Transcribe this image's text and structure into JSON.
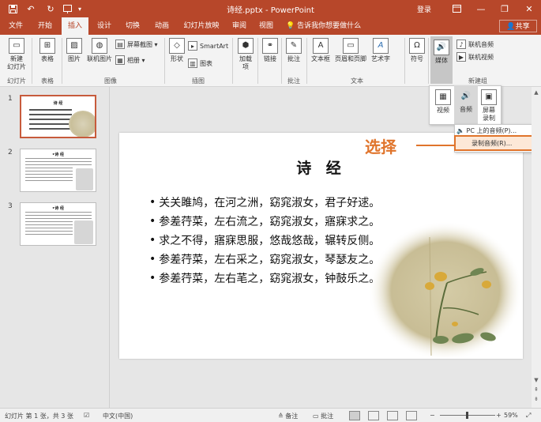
{
  "titlebar": {
    "doc_title": "诗经.pptx - PowerPoint",
    "login": "登录",
    "minimize": "—",
    "restore": "❐",
    "close": "✕"
  },
  "tabs": [
    "文件",
    "开始",
    "插入",
    "设计",
    "切换",
    "动画",
    "幻灯片放映",
    "审阅",
    "视图"
  ],
  "tell_me": "告诉我你想要做什么",
  "share": "共享",
  "ribbon": {
    "new_slide_1": "新建",
    "new_slide_2": "幻灯片",
    "table": "表格",
    "picture": "图片",
    "online_picture": "联机图片",
    "screenshot": "屏幕截图",
    "album": "相册",
    "shapes": "形状",
    "smartart": "SmartArt",
    "chart": "图表",
    "addins_1": "加载",
    "addins_2": "项",
    "link": "链接",
    "comment": "批注",
    "textbox": "文本框",
    "header_footer": "页眉和页脚",
    "wordart": "艺术字",
    "symbol": "符号",
    "media": "媒体",
    "online_audio": "联机音频",
    "online_video": "联机视频",
    "groups": {
      "slides": "幻灯片",
      "tables": "表格",
      "images": "图像",
      "illustrations": "插图",
      "comments": "批注",
      "text": "文本",
      "new_group": "新建组"
    }
  },
  "media_panel": {
    "video": "视频",
    "audio": "音频",
    "screen_1": "屏幕",
    "screen_2": "录制"
  },
  "audio_menu": {
    "pc_audio": "PC 上的音频(P)...",
    "record_audio": "录制音频(R)..."
  },
  "callout": "选择",
  "thumbnails": [
    {
      "num": "1",
      "title": "诗  经"
    },
    {
      "num": "2",
      "title": "•诗  经"
    },
    {
      "num": "3",
      "title": "•诗  经"
    }
  ],
  "slide": {
    "title": "诗 经",
    "lines": [
      "关关雎鸠，在河之洲，窈窕淑女，君子好逑。",
      "参差荇菜，左右流之，窈窕淑女，寤寐求之。",
      "求之不得，寤寐思服，悠哉悠哉，辗转反侧。",
      "参差荇菜，左右采之，窈窕淑女，琴瑟友之。",
      "参差荇菜，左右芼之，窈窕淑女，钟鼓乐之。"
    ]
  },
  "statusbar": {
    "slide_info": "幻灯片 第 1 张，共 3 张",
    "language": "中文(中国)",
    "notes": "备注",
    "comments": "批注",
    "zoom": "59%"
  },
  "colors": {
    "brand": "#b7472a",
    "callout": "#e0742b"
  }
}
